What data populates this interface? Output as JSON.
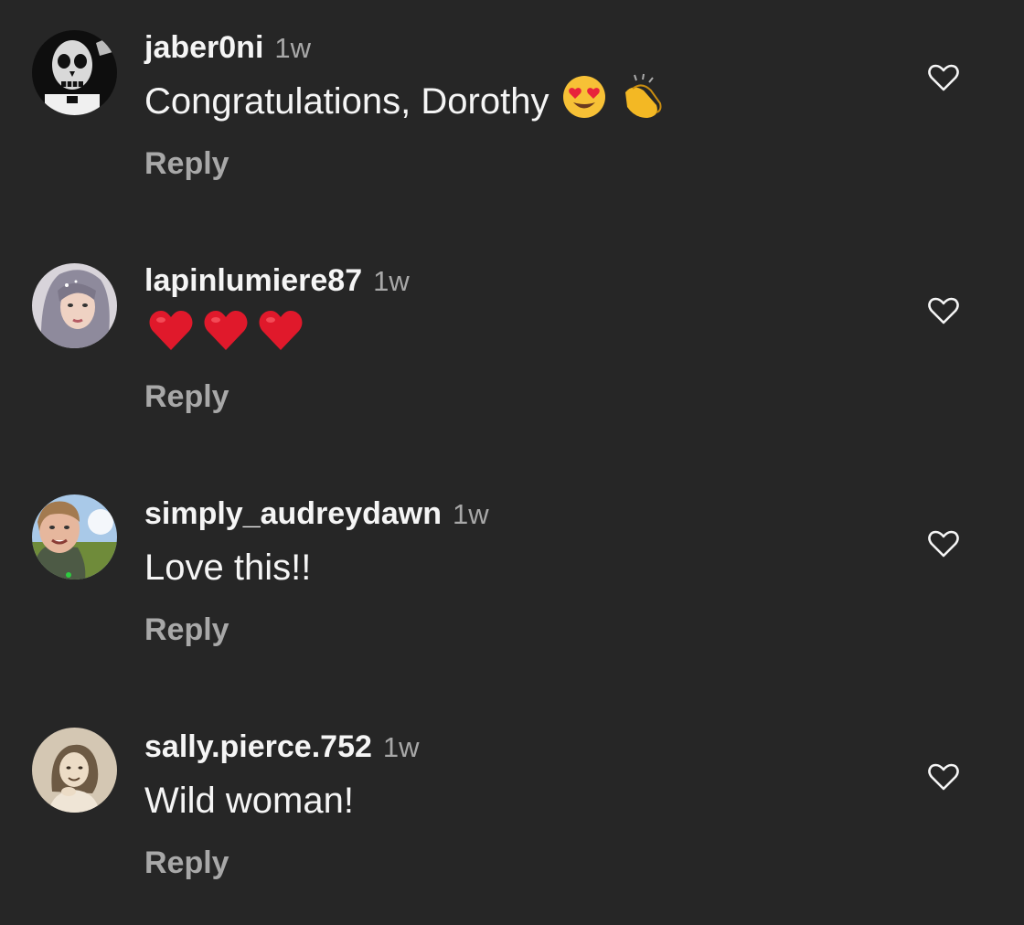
{
  "comments": [
    {
      "username": "jaber0ni",
      "time": "1w",
      "text": "Congratulations, Dorothy",
      "emojis": [
        "heart-eyes-emoji",
        "clapping-hands-emoji"
      ],
      "reply_label": "Reply",
      "avatar": "skull-face-avatar"
    },
    {
      "username": "lapinlumiere87",
      "time": "1w",
      "text": "",
      "emojis": [
        "red-heart-emoji",
        "red-heart-emoji",
        "red-heart-emoji"
      ],
      "reply_label": "Reply",
      "avatar": "purple-hair-woman-avatar"
    },
    {
      "username": "simply_audreydawn",
      "time": "1w",
      "text": "Love this!!",
      "emojis": [],
      "reply_label": "Reply",
      "avatar": "outdoor-selfie-avatar"
    },
    {
      "username": "sally.pierce.752",
      "time": "1w",
      "text": "Wild woman!",
      "emojis": [],
      "reply_label": "Reply",
      "avatar": "vintage-girl-photo-avatar"
    }
  ],
  "colors": {
    "background": "#262626",
    "primary_text": "#f5f5f5",
    "secondary_text": "#a8a8a8",
    "heart_red": "#e0192b"
  }
}
